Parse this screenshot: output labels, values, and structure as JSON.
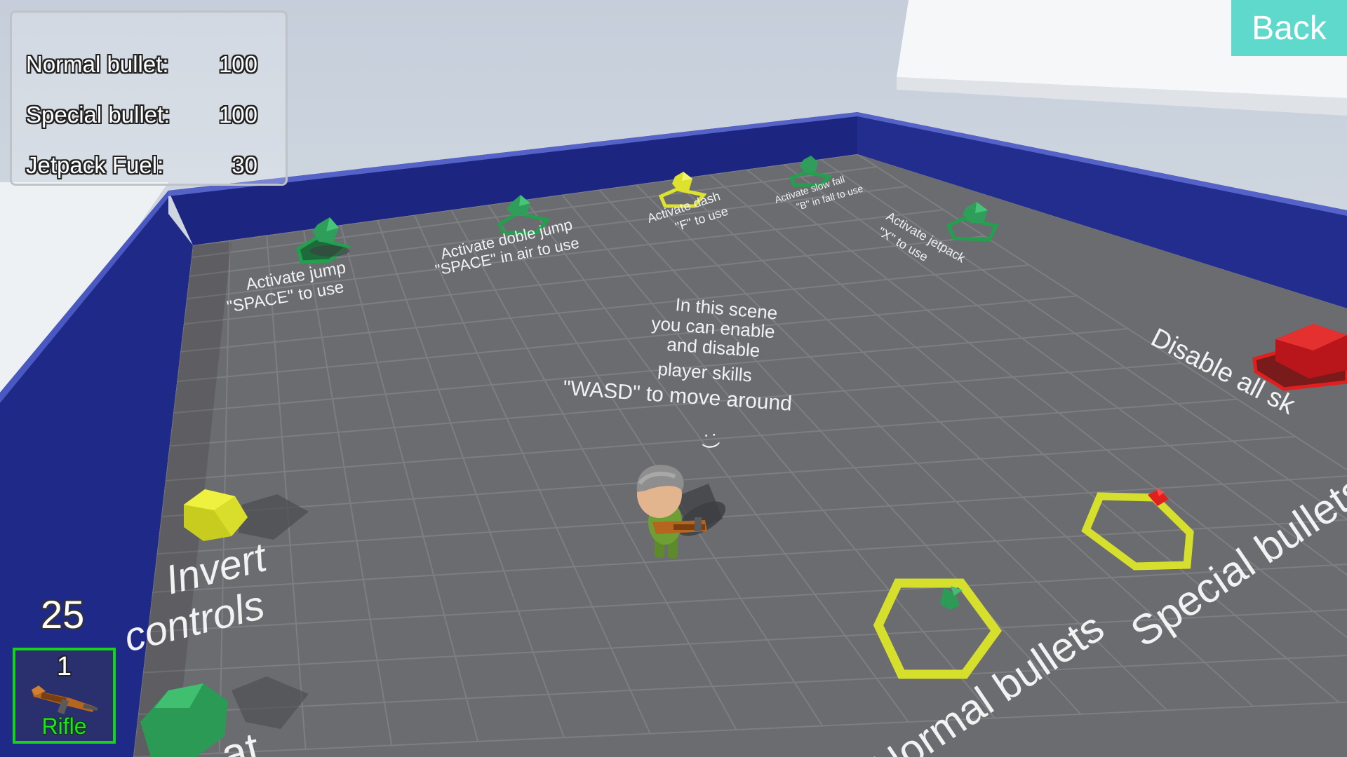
{
  "hud": {
    "stats": [
      {
        "label": "Normal bullet:",
        "value": "100"
      },
      {
        "label": "Special bullet:",
        "value": "100"
      },
      {
        "label": "Jetpack Fuel:",
        "value": "30"
      }
    ],
    "back_label": "Back",
    "ammo_count": "25",
    "weapon_slot": {
      "number": "1",
      "name": "Rifle",
      "icon": "rifle-icon"
    }
  },
  "world": {
    "skills": [
      {
        "line1": "Activate jump",
        "line2": "\"SPACE\" to use"
      },
      {
        "line1": "Activate doble jump",
        "line2": "\"SPACE\" in air to use"
      },
      {
        "line1": "Activate dash",
        "line2": "\"F\" to use"
      },
      {
        "line1": "Activate slow fall",
        "line2": "\"B\" in fall to use"
      },
      {
        "line1": "Activate jetpack",
        "line2": "\"X\" to use"
      }
    ],
    "info_lines": [
      "In this scene",
      "you can enable",
      "and disable",
      "player skills",
      "\"WASD\" to move around",
      ": )"
    ],
    "disable_label": "Disable all sk",
    "invert_line1": "Invert",
    "invert_line2": "controls",
    "normal_bullets": "Normal bullets",
    "special_bullets": "Special bullets"
  },
  "colors": {
    "floor": "#6b6c70",
    "wall": "#1f2a88",
    "sky": "#c7d0db",
    "accent_teal": "#5fd9cc",
    "pickup_green": "#2e9e5a",
    "pickup_yellow": "#dde22e",
    "pickup_red": "#e11f1f",
    "slot_border": "#17d41a"
  }
}
